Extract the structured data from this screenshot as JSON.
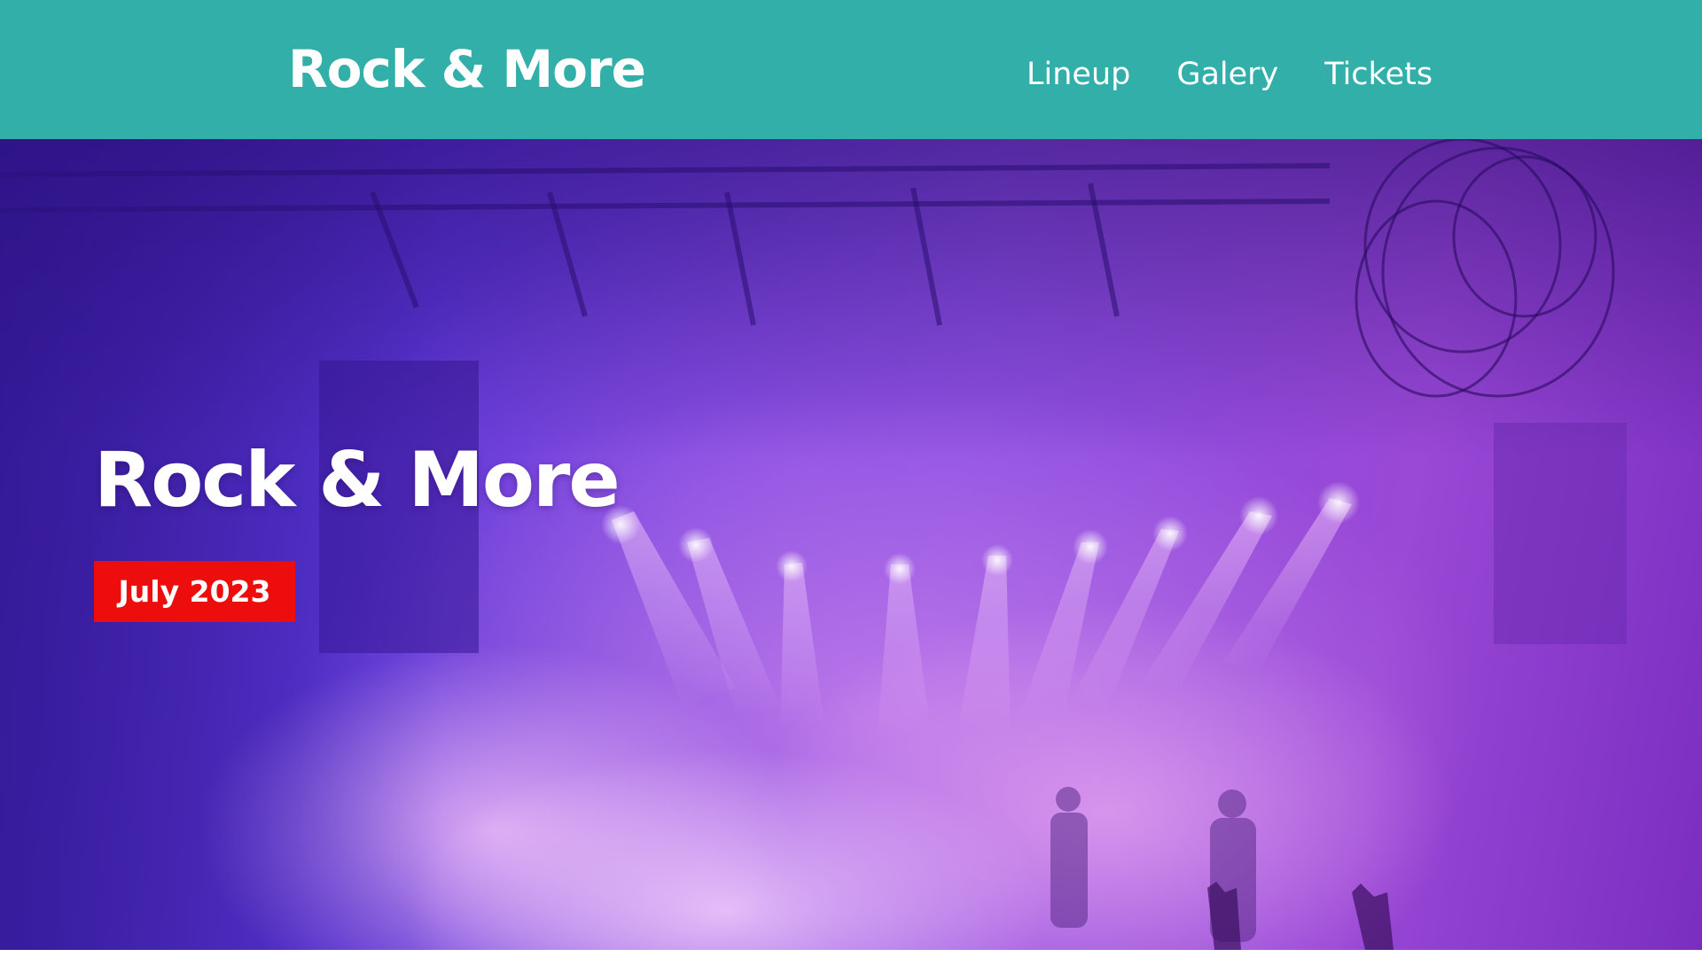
{
  "header": {
    "brand": "Rock & More",
    "nav": [
      {
        "label": "Lineup"
      },
      {
        "label": "Galery"
      },
      {
        "label": "Tickets"
      }
    ]
  },
  "hero": {
    "title": "Rock & More",
    "date_badge": "July 2023"
  },
  "colors": {
    "header_bg": "#33afa9",
    "badge_bg": "#ee0d0d",
    "hero_tint": "#8a4ee0"
  }
}
